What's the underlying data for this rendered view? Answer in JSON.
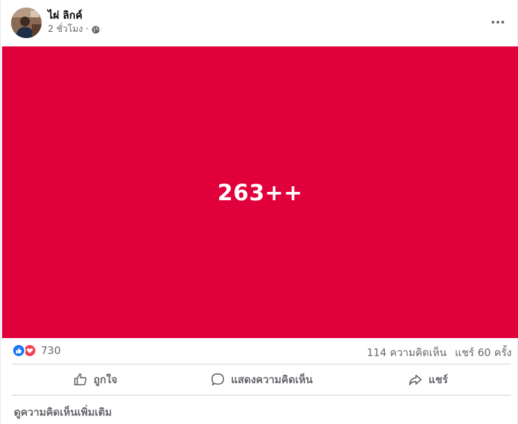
{
  "post": {
    "author": "ไผ่ ลิกค์",
    "time": "2 ชั่วโมง",
    "separator": "·",
    "privacy_icon": "globe-icon",
    "more_icon": "more-horizontal-icon",
    "image_text": "263++",
    "image_bg": "#e0003c"
  },
  "stats": {
    "reaction_icons": [
      "like-icon",
      "love-icon"
    ],
    "reaction_count": "730",
    "comments": "114 ความคิดเห็น",
    "shares": "แชร์ 60 ครั้ง"
  },
  "actions": {
    "like": "ถูกใจ",
    "comment": "แสดงความคิดเห็น",
    "share": "แชร์"
  },
  "more_comments": "ดูความคิดเห็นเพิ่มเติม"
}
